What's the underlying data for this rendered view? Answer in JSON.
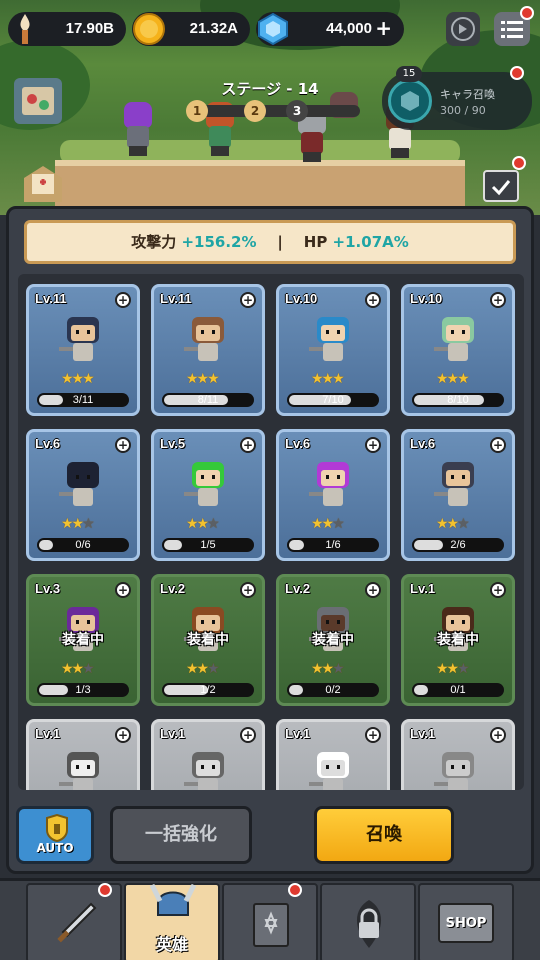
{
  "header": {
    "power": "17.90B",
    "gold": "21.32A",
    "gems": "44,000",
    "add_gems": "+",
    "icons": [
      "torch-icon",
      "coin-icon",
      "gem-icon",
      "fast-forward-icon",
      "menu-icon"
    ]
  },
  "stage": {
    "title": "ステージ - 14",
    "nodes": [
      "1",
      "2",
      "3"
    ]
  },
  "summon_panel": {
    "badge": "15",
    "label": "キャラ召喚",
    "count": "300 / 90"
  },
  "bonus": {
    "atk_label": "攻撃力 ",
    "atk_value": "+156.2%",
    "sep": "|",
    "hp_label": "HP ",
    "hp_value": "+1.07A%"
  },
  "equip_label": "装着中",
  "cards": [
    {
      "lv": "Lv.11",
      "stars": 3,
      "progress": "3/11",
      "fill": 0.27,
      "style": "blue"
    },
    {
      "lv": "Lv.11",
      "stars": 3,
      "progress": "8/11",
      "fill": 0.73,
      "style": "blue"
    },
    {
      "lv": "Lv.10",
      "stars": 3,
      "progress": "7/10",
      "fill": 0.7,
      "style": "blue"
    },
    {
      "lv": "Lv.10",
      "stars": 3,
      "progress": "8/10",
      "fill": 0.8,
      "style": "blue"
    },
    {
      "lv": "Lv.6",
      "stars": 2,
      "progress": "0/6",
      "fill": 0.0,
      "style": "blue"
    },
    {
      "lv": "Lv.5",
      "stars": 2,
      "progress": "1/5",
      "fill": 0.2,
      "style": "blue"
    },
    {
      "lv": "Lv.6",
      "stars": 2,
      "progress": "1/6",
      "fill": 0.17,
      "style": "blue"
    },
    {
      "lv": "Lv.6",
      "stars": 2,
      "progress": "2/6",
      "fill": 0.33,
      "style": "blue"
    },
    {
      "lv": "Lv.3",
      "stars": 2,
      "progress": "1/3",
      "fill": 0.33,
      "style": "green",
      "equipped": true
    },
    {
      "lv": "Lv.2",
      "stars": 2,
      "progress": "1/2",
      "fill": 0.5,
      "style": "green",
      "equipped": true
    },
    {
      "lv": "Lv.2",
      "stars": 2,
      "progress": "0/2",
      "fill": 0.0,
      "style": "green",
      "equipped": true
    },
    {
      "lv": "Lv.1",
      "stars": 2,
      "progress": "0/1",
      "fill": 0.0,
      "style": "green",
      "equipped": true
    },
    {
      "lv": "Lv.1",
      "stars": 0,
      "progress": "",
      "fill": 0,
      "style": "gray"
    },
    {
      "lv": "Lv.1",
      "stars": 0,
      "progress": "",
      "fill": 0,
      "style": "gray"
    },
    {
      "lv": "Lv.1",
      "stars": 0,
      "progress": "",
      "fill": 0,
      "style": "gray"
    },
    {
      "lv": "Lv.1",
      "stars": 0,
      "progress": "",
      "fill": 0,
      "style": "gray"
    }
  ],
  "buttons": {
    "auto": "AUTO",
    "bulk_upgrade": "一括強化",
    "summon": "召喚"
  },
  "nav": {
    "hero_label": "英雄",
    "shop_label": "SHOP"
  },
  "colors": {
    "accent_gold": "#f2a812",
    "stat_teal": "#1fa5a5",
    "alert_red": "#e03a2f"
  }
}
